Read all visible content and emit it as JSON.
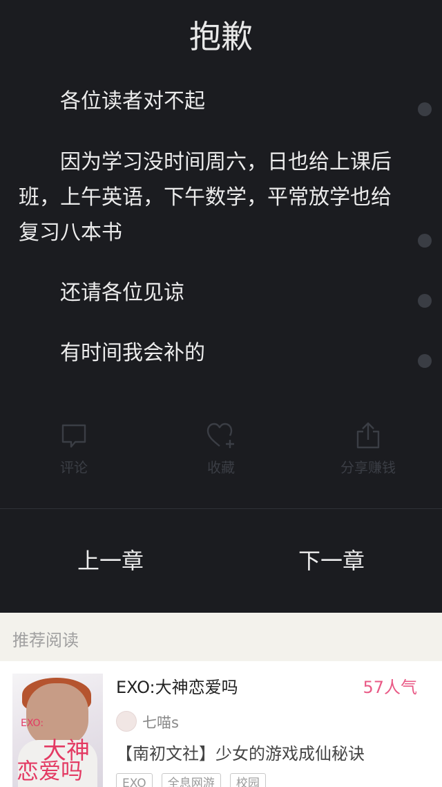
{
  "chapter": {
    "title": "抱歉",
    "paragraphs": [
      "各位读者对不起",
      "因为学习没时间周六，日也给上课后班，上午英语，下午数学，平常放学也给复习八本书",
      "还请各位见谅",
      "有时间我会补的"
    ]
  },
  "actions": {
    "comment": {
      "label": "评论",
      "icon": "comment-bubble-icon"
    },
    "favorite": {
      "label": "收藏",
      "icon": "heart-plus-icon"
    },
    "share": {
      "label": "分享赚钱",
      "icon": "share-upload-icon"
    }
  },
  "navigation": {
    "prev": "上一章",
    "next": "下一章"
  },
  "recommend": {
    "header": "推荐阅读",
    "book": {
      "title": "EXO:大神恋爱吗",
      "popularity": "57人气",
      "author": "七喵s",
      "description": "【南初文社】少女的游戏成仙秘诀",
      "tags": [
        "EXO",
        "全息网游",
        "校园"
      ],
      "cover": {
        "line1": "EXO:",
        "line2": "大神",
        "line3": "恋爱吗"
      }
    }
  },
  "colors": {
    "reader_bg": "#1b1c20",
    "text": "#ececec",
    "accent_pink": "#e95a86",
    "muted_icon": "#3b3e45"
  }
}
